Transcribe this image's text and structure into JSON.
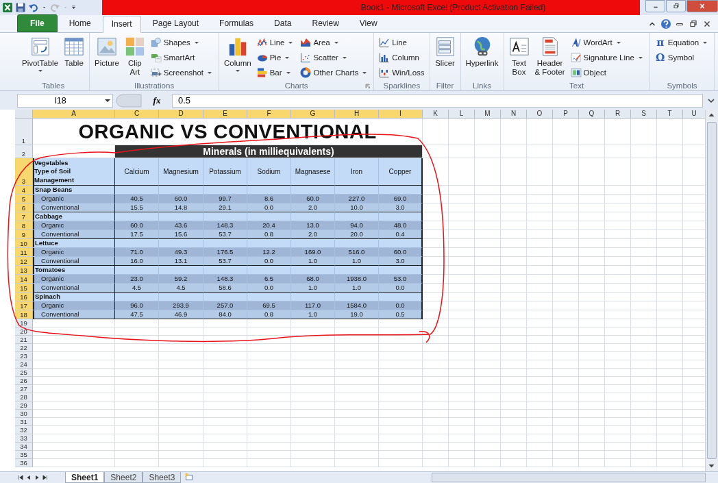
{
  "window": {
    "title": "Book1  -  Microsoft Excel (Product Activation Failed)"
  },
  "tabs": [
    {
      "label": "File",
      "kind": "file",
      "selected": false
    },
    {
      "label": "Home",
      "kind": "tab",
      "selected": false
    },
    {
      "label": "Insert",
      "kind": "tab",
      "selected": true
    },
    {
      "label": "Page Layout",
      "kind": "tab",
      "selected": false
    },
    {
      "label": "Formulas",
      "kind": "tab",
      "selected": false
    },
    {
      "label": "Data",
      "kind": "tab",
      "selected": false
    },
    {
      "label": "Review",
      "kind": "tab",
      "selected": false
    },
    {
      "label": "View",
      "kind": "tab",
      "selected": false
    }
  ],
  "ribbon": {
    "groups": [
      {
        "label": "Tables",
        "launcher": false,
        "items": [
          {
            "label": "PivotTable",
            "kind": "large",
            "dropdown": true
          },
          {
            "label": "Table",
            "kind": "large",
            "dropdown": false
          }
        ]
      },
      {
        "label": "Illustrations",
        "launcher": false,
        "items": [
          {
            "label": "Picture",
            "kind": "large",
            "dropdown": false
          },
          {
            "label": "Clip\nArt",
            "kind": "large",
            "dropdown": false
          },
          {
            "label": "Shapes",
            "kind": "small",
            "dropdown": true
          },
          {
            "label": "SmartArt",
            "kind": "small",
            "dropdown": false
          },
          {
            "label": "Screenshot",
            "kind": "small",
            "dropdown": true
          }
        ]
      },
      {
        "label": "Charts",
        "launcher": true,
        "items": [
          {
            "label": "Column",
            "kind": "large",
            "dropdown": true
          },
          {
            "label": "Line",
            "kind": "small",
            "dropdown": true
          },
          {
            "label": "Pie",
            "kind": "small",
            "dropdown": true
          },
          {
            "label": "Bar",
            "kind": "small",
            "dropdown": true
          },
          {
            "label": "Area",
            "kind": "small",
            "dropdown": true
          },
          {
            "label": "Scatter",
            "kind": "small",
            "dropdown": true
          },
          {
            "label": "Other Charts",
            "kind": "small",
            "dropdown": true
          }
        ]
      },
      {
        "label": "Sparklines",
        "launcher": false,
        "items": [
          {
            "label": "Line",
            "kind": "small",
            "dropdown": false
          },
          {
            "label": "Column",
            "kind": "small",
            "dropdown": false
          },
          {
            "label": "Win/Loss",
            "kind": "small",
            "dropdown": false
          }
        ]
      },
      {
        "label": "Filter",
        "launcher": false,
        "items": [
          {
            "label": "Slicer",
            "kind": "large",
            "dropdown": false
          }
        ]
      },
      {
        "label": "Links",
        "launcher": false,
        "items": [
          {
            "label": "Hyperlink",
            "kind": "large",
            "dropdown": false
          }
        ]
      },
      {
        "label": "Text",
        "launcher": false,
        "items": [
          {
            "label": "Text\nBox",
            "kind": "large",
            "dropdown": false
          },
          {
            "label": "Header\n& Footer",
            "kind": "large",
            "dropdown": false
          },
          {
            "label": "WordArt",
            "kind": "small",
            "dropdown": true
          },
          {
            "label": "Signature Line",
            "kind": "small",
            "dropdown": true
          },
          {
            "label": "Object",
            "kind": "small",
            "dropdown": false
          }
        ]
      },
      {
        "label": "Symbols",
        "launcher": false,
        "items": [
          {
            "label": "Equation",
            "kind": "small",
            "dropdown": true,
            "icon": "π"
          },
          {
            "label": "Symbol",
            "kind": "small",
            "dropdown": false,
            "icon": "Ω"
          }
        ]
      }
    ]
  },
  "formula_bar": {
    "name_box": "I18",
    "function_label": "fx",
    "value": "0.5"
  },
  "sheet": {
    "column_headers": [
      {
        "label": "A",
        "selected": true
      },
      {
        "label": "C",
        "selected": true
      },
      {
        "label": "D",
        "selected": true
      },
      {
        "label": "E",
        "selected": true
      },
      {
        "label": "F",
        "selected": true
      },
      {
        "label": "G",
        "selected": true
      },
      {
        "label": "H",
        "selected": true
      },
      {
        "label": "I",
        "selected": true
      },
      {
        "label": "K",
        "selected": false
      },
      {
        "label": "L",
        "selected": false
      },
      {
        "label": "M",
        "selected": false
      },
      {
        "label": "N",
        "selected": false
      },
      {
        "label": "O",
        "selected": false
      },
      {
        "label": "P",
        "selected": false
      },
      {
        "label": "Q",
        "selected": false
      },
      {
        "label": "R",
        "selected": false
      },
      {
        "label": "S",
        "selected": false
      },
      {
        "label": "T",
        "selected": false
      },
      {
        "label": "U",
        "selected": false
      }
    ],
    "row_headers": [
      {
        "label": "1",
        "selected": false
      },
      {
        "label": "2",
        "selected": false
      },
      {
        "label": "3",
        "selected": true
      },
      {
        "label": "4",
        "selected": true
      },
      {
        "label": "5",
        "selected": true
      },
      {
        "label": "6",
        "selected": true
      },
      {
        "label": "7",
        "selected": true
      },
      {
        "label": "8",
        "selected": true
      },
      {
        "label": "9",
        "selected": true
      },
      {
        "label": "10",
        "selected": true
      },
      {
        "label": "11",
        "selected": true
      },
      {
        "label": "12",
        "selected": true
      },
      {
        "label": "13",
        "selected": true
      },
      {
        "label": "14",
        "selected": true
      },
      {
        "label": "15",
        "selected": true
      },
      {
        "label": "16",
        "selected": true
      },
      {
        "label": "17",
        "selected": true
      },
      {
        "label": "18",
        "selected": true
      },
      {
        "label": "19",
        "selected": false
      },
      {
        "label": "20",
        "selected": false
      },
      {
        "label": "21",
        "selected": false
      },
      {
        "label": "22",
        "selected": false
      },
      {
        "label": "23",
        "selected": false
      },
      {
        "label": "24",
        "selected": false
      },
      {
        "label": "25",
        "selected": false
      },
      {
        "label": "26",
        "selected": false
      },
      {
        "label": "27",
        "selected": false
      },
      {
        "label": "28",
        "selected": false
      },
      {
        "label": "29",
        "selected": false
      },
      {
        "label": "30",
        "selected": false
      },
      {
        "label": "31",
        "selected": false
      },
      {
        "label": "32",
        "selected": false
      },
      {
        "label": "33",
        "selected": false
      },
      {
        "label": "34",
        "selected": false
      },
      {
        "label": "35",
        "selected": false
      },
      {
        "label": "36",
        "selected": false
      }
    ],
    "title": "ORGANIC VS CONVENTIONAL",
    "subtitle": "Minerals (in milliequivalents)",
    "header_label": "Vegetables\nType of Soil\nManagement",
    "minerals": [
      "Calcium",
      "Magnesium",
      "Potassium",
      "Sodium",
      "Magnasese",
      "Iron",
      "Copper"
    ],
    "groups": [
      {
        "name": "Snap Beans",
        "rows": [
          {
            "label": "Organic",
            "values": [
              "40.5",
              "60.0",
              "99.7",
              "8.6",
              "60.0",
              "227.0",
              "69.0"
            ]
          },
          {
            "label": "Conventional",
            "values": [
              "15.5",
              "14.8",
              "29.1",
              "0.0",
              "2.0",
              "10.0",
              "3.0"
            ]
          }
        ]
      },
      {
        "name": "Cabbage",
        "rows": [
          {
            "label": "Organic",
            "values": [
              "60.0",
              "43.6",
              "148.3",
              "20.4",
              "13.0",
              "94.0",
              "48.0"
            ]
          },
          {
            "label": "Conventional",
            "values": [
              "17.5",
              "15.6",
              "53.7",
              "0.8",
              "2.0",
              "20.0",
              "0.4"
            ]
          }
        ]
      },
      {
        "name": "Lettuce",
        "rows": [
          {
            "label": "Organic",
            "values": [
              "71.0",
              "49.3",
              "176.5",
              "12.2",
              "169.0",
              "516.0",
              "60.0"
            ]
          },
          {
            "label": "Conventional",
            "values": [
              "16.0",
              "13.1",
              "53.7",
              "0.0",
              "1.0",
              "1.0",
              "3.0"
            ]
          }
        ]
      },
      {
        "name": "Tomatoes",
        "rows": [
          {
            "label": "Organic",
            "values": [
              "23.0",
              "59.2",
              "148.3",
              "6.5",
              "68.0",
              "1938.0",
              "53.0"
            ]
          },
          {
            "label": "Conventional",
            "values": [
              "4.5",
              "4.5",
              "58.6",
              "0.0",
              "1.0",
              "1.0",
              "0.0"
            ]
          }
        ]
      },
      {
        "name": "Spinach",
        "rows": [
          {
            "label": "Organic",
            "values": [
              "96.0",
              "293.9",
              "257.0",
              "69.5",
              "117.0",
              "1584.0",
              "0.0"
            ]
          },
          {
            "label": "Conventional",
            "values": [
              "47.5",
              "46.9",
              "84.0",
              "0.8",
              "1.0",
              "19.0",
              "0.5"
            ]
          }
        ]
      }
    ]
  },
  "sheet_tabs": [
    {
      "label": "Sheet1",
      "selected": true
    },
    {
      "label": "Sheet2",
      "selected": false
    },
    {
      "label": "Sheet3",
      "selected": false
    }
  ]
}
